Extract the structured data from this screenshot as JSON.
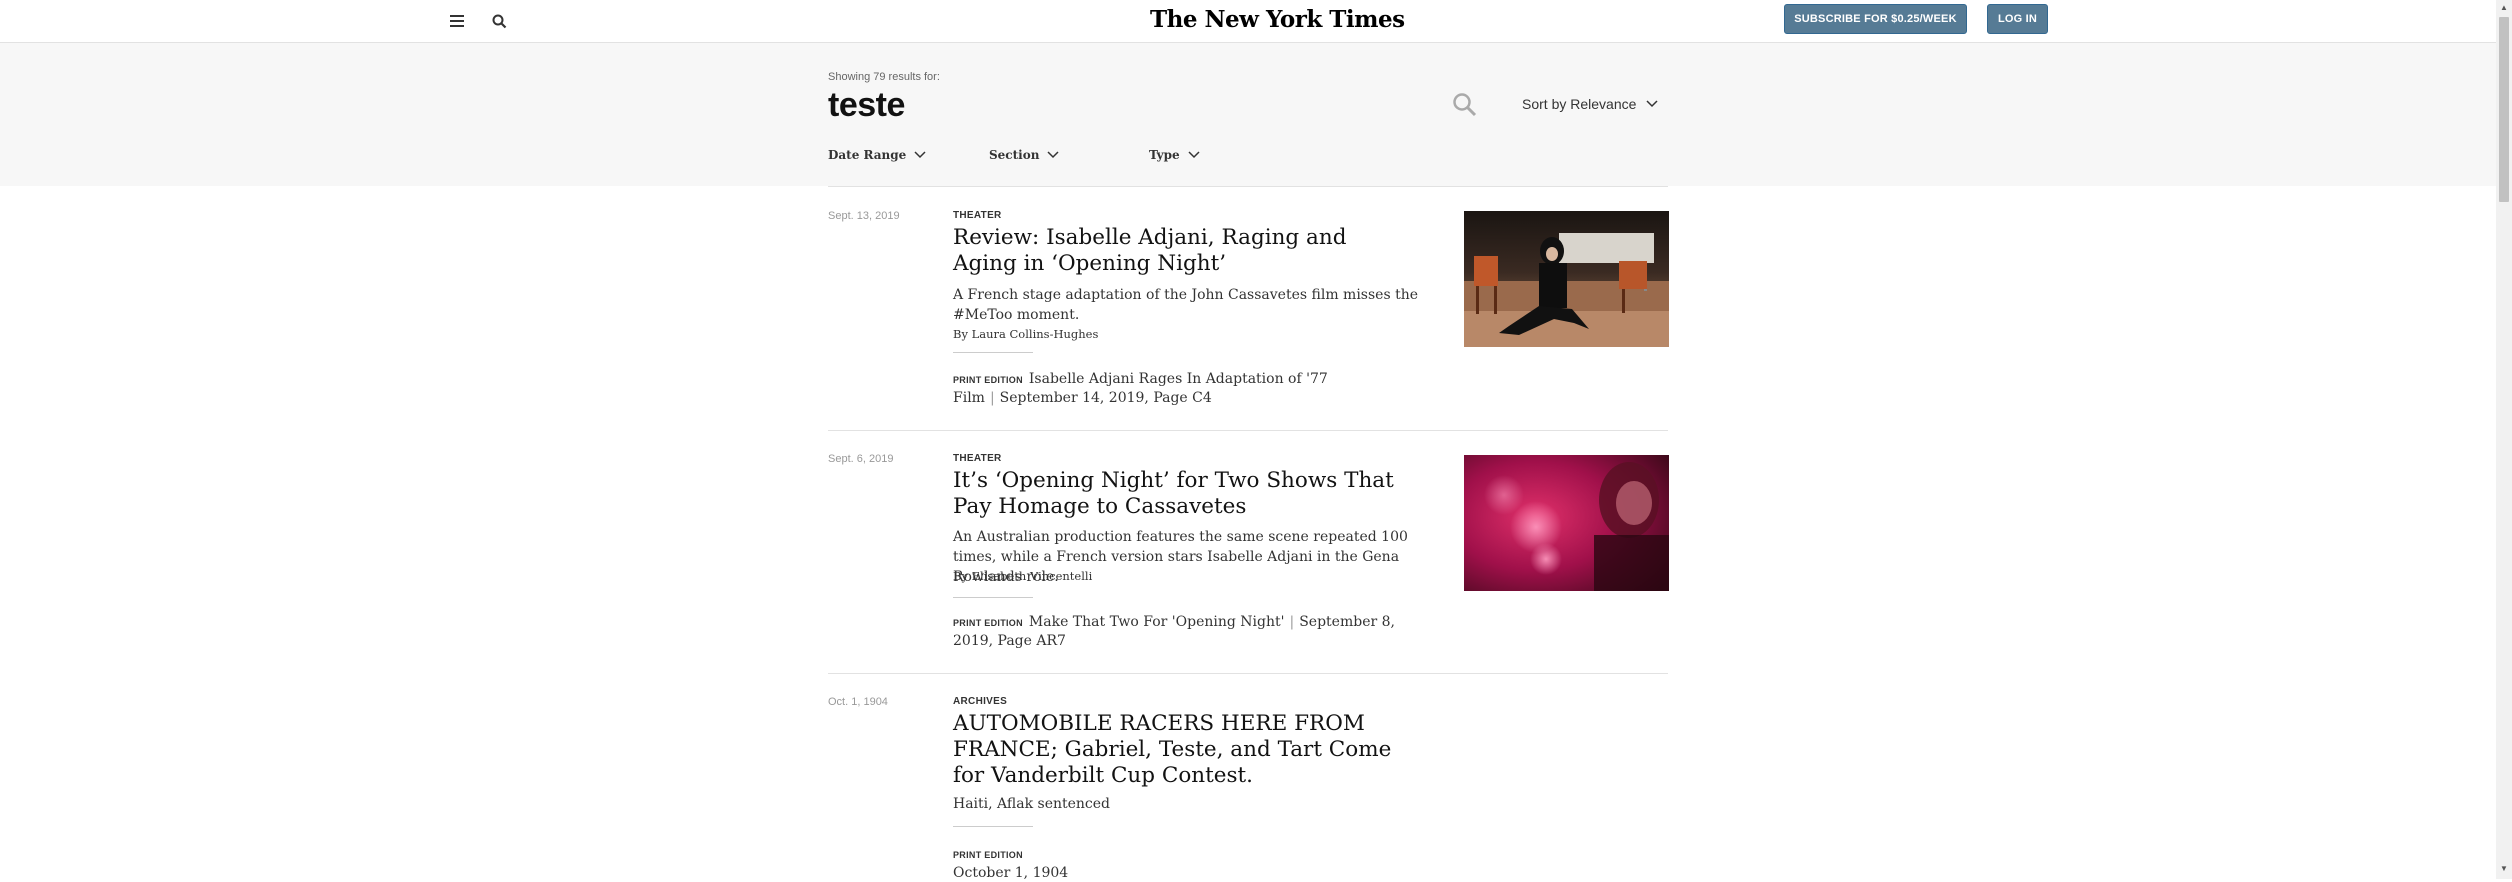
{
  "header": {
    "logo": "The New York Times",
    "subscribe_label": "SUBSCRIBE FOR $0.25/WEEK",
    "login_label": "LOG IN"
  },
  "search": {
    "showing_text": "Showing 79 results for:",
    "query": "teste",
    "sort_label": "Sort by Relevance",
    "filters": [
      "Date Range",
      "Section",
      "Type"
    ]
  },
  "results": [
    {
      "date": "Sept. 13, 2019",
      "section": "THEATER",
      "headline": "Review: Isabelle Adjani, Raging and Aging in ‘Opening Night’",
      "summary": "A French stage adaptation of the John Cassavetes film misses the #MeToo moment.",
      "byline": "By Laura Collins-Hughes",
      "print_label": "PRINT EDITION",
      "print_title": "Isabelle Adjani Rages In Adaptation of '77 Film",
      "print_date": "September 14, 2019, Page C4"
    },
    {
      "date": "Sept. 6, 2019",
      "section": "THEATER",
      "headline": "It’s ‘Opening Night’ for Two Shows That Pay Homage to Cassavetes",
      "summary": "An Australian production features the same scene repeated 100 times, while a French version stars Isabelle Adjani in the Gena Rowlands role.",
      "byline": "By Elisabeth Vincentelli",
      "print_label": "PRINT EDITION",
      "print_title": "Make That Two For 'Opening Night'",
      "print_date": "September 8, 2019, Page AR7"
    },
    {
      "date": "Oct. 1, 1904",
      "section": "ARCHIVES",
      "headline": "AUTOMOBILE RACERS HERE FROM FRANCE; Gabriel, Teste, and Tart Come for Vanderbilt Cup Contest.",
      "summary": "Haiti, Aflak sentenced",
      "print_label": "PRINT EDITION",
      "print_date": "October 1, 1904"
    }
  ],
  "colors": {
    "button_bg": "#567b95",
    "panel_bg": "#f7f7f7"
  }
}
